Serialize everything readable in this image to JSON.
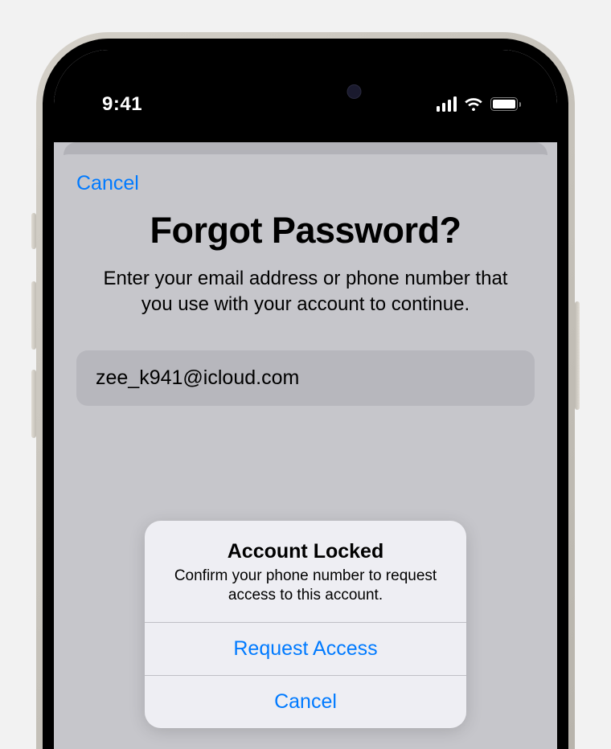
{
  "status_bar": {
    "time": "9:41"
  },
  "nav": {
    "cancel_label": "Cancel"
  },
  "page": {
    "title": "Forgot Password?",
    "subtitle": "Enter your email address or phone number that you use with your account to continue."
  },
  "input": {
    "email_value": "zee_k941@icloud.com"
  },
  "alert": {
    "title": "Account Locked",
    "message": "Confirm your phone number to request access to this account.",
    "primary_button": "Request Access",
    "secondary_button": "Cancel"
  }
}
